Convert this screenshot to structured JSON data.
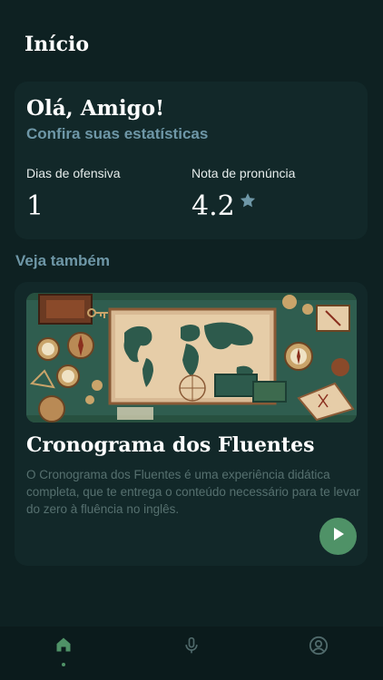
{
  "header": {
    "title": "Início"
  },
  "stats": {
    "greeting": "Olá, Amigo!",
    "subtitle": "Confira suas estatísticas",
    "streak_label": "Dias de ofensiva",
    "streak_value": "1",
    "pronunciation_label": "Nota de pronúncia",
    "pronunciation_value": "4.2",
    "star_icon": "star-icon"
  },
  "see_also": {
    "title": "Veja também",
    "course": {
      "title": "Cronograma dos Fluentes",
      "description": "O Cronograma dos Fluentes é uma experiência didática completa, que te entrega o conteúdo necessário para te levar do zero à fluência no inglês.",
      "image": "world-map-illustration",
      "action_icon": "play-icon"
    }
  },
  "nav": {
    "items": [
      {
        "icon": "home-icon",
        "active": true
      },
      {
        "icon": "microphone-icon",
        "active": false
      },
      {
        "icon": "profile-icon",
        "active": false
      }
    ]
  },
  "colors": {
    "background": "#0e2122",
    "card": "#122829",
    "accent": "#4f9267",
    "muted_blue": "#6e97a7",
    "nav_background": "#0b1b1c"
  }
}
